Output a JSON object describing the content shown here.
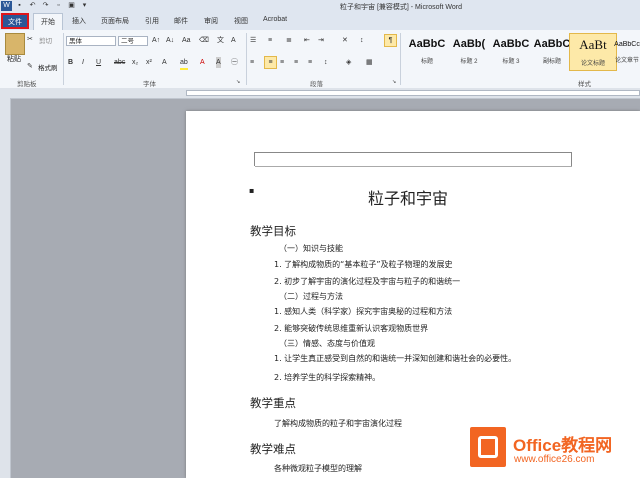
{
  "window": {
    "title": "粒子和宇宙 [兼容模式] - Microsoft Word"
  },
  "tabs": {
    "file": "文件",
    "home": "开始",
    "insert": "插入",
    "layout": "页面布局",
    "references": "引用",
    "mailings": "邮件",
    "review": "审阅",
    "view": "视图",
    "acrobat": "Acrobat"
  },
  "ribbon": {
    "clipboard": {
      "paste": "粘贴",
      "cut": "剪切",
      "format_painter": "格式刷",
      "label": "剪贴板"
    },
    "font": {
      "name": "黑体",
      "size": "二号",
      "label": "字体"
    },
    "paragraph": {
      "label": "段落"
    },
    "styles": {
      "label": "样式",
      "items": [
        {
          "sample": "AaBbC",
          "name": "标题"
        },
        {
          "sample": "AaBb(",
          "name": "标题 2"
        },
        {
          "sample": "AaBbC",
          "name": "标题 3"
        },
        {
          "sample": "AaBbC",
          "name": "副标题"
        },
        {
          "sample": "AaBt",
          "name": "论文标题"
        },
        {
          "sample": "AaBbCc",
          "name": "论文章节"
        }
      ]
    }
  },
  "document": {
    "title": "粒子和宇宙",
    "sections": [
      {
        "heading": "教学目标",
        "lines": [
          "（一）知识与技能",
          "1. 了解构成物质的“基本粒子”及粒子物理的发展史",
          "2. 初步了解宇宙的演化过程及宇宙与粒子的和谐统一",
          "（二）过程与方法",
          "1. 感知人类（科学家）探究宇宙奥秘的过程和方法",
          "2. 能够突破传统思维重新认识客观物质世界",
          "（三）情感、态度与价值观",
          "1. 让学生真正感受到自然的和谐统一并深知创建和谐社会的必要性。",
          "2. 培养学生的科学探索精神。"
        ]
      },
      {
        "heading": "教学重点",
        "lines": [
          "了解构成物质的粒子和宇宙演化过程"
        ]
      },
      {
        "heading": "教学难点",
        "lines": [
          "各种微观粒子模型的理解"
        ]
      }
    ]
  },
  "watermark": {
    "brand": "Office教程网",
    "url": "www.office26.com"
  },
  "colors": {
    "file_tab": "#2b5797",
    "highlight": "#e0161b",
    "logo_orange": "#f26522"
  }
}
